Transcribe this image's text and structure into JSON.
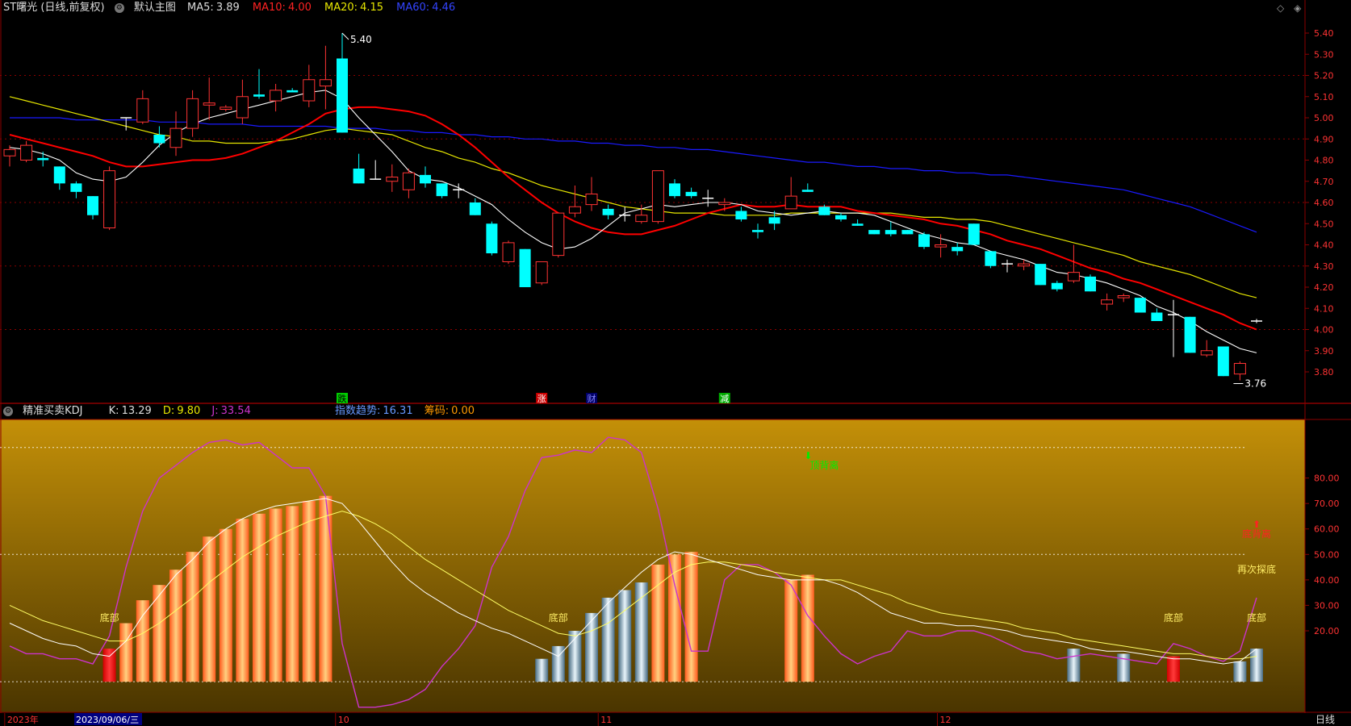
{
  "header": {
    "title": "ST曙光 (日线,前复权)",
    "main_chart_label": "默认主图",
    "ma5_label": "MA5:",
    "ma5_value": "3.89",
    "ma10_label": "MA10:",
    "ma10_value": "4.00",
    "ma20_label": "MA20:",
    "ma20_value": "4.15",
    "ma60_label": "MA60:",
    "ma60_value": "4.46",
    "window_controls": [
      "◇",
      "◈"
    ]
  },
  "sub_header": {
    "title": "精准买卖KDJ",
    "k_label": "K:",
    "k_value": "13.29",
    "d_label": "D:",
    "d_value": "9.80",
    "j_label": "J:",
    "j_value": "33.54",
    "index_trend_label": "指数趋势:",
    "index_trend_value": "16.31",
    "chips_label": "筹码:",
    "chips_value": "0.00"
  },
  "colors": {
    "up": "#ff3333",
    "down": "#00ffff",
    "ma5": "#ffffff",
    "ma10": "#ff0000",
    "ma20": "#e6e600",
    "ma60": "#1a1aff",
    "k_line": "#ffffff",
    "d_line": "#ffff66",
    "j_line": "#cc33cc",
    "grid": "#8b0000"
  },
  "chart_data": [
    {
      "type": "candlestick",
      "title": "ST曙光 (日线,前复权)",
      "y_ticks": [
        "5.40",
        "5.30",
        "5.20",
        "5.10",
        "5.00",
        "4.90",
        "4.80",
        "4.70",
        "4.60",
        "4.50",
        "4.40",
        "4.30",
        "4.20",
        "4.10",
        "4.00",
        "3.90",
        "3.80"
      ],
      "ylim": [
        3.72,
        5.48
      ],
      "annotations": {
        "max_label": "5.40",
        "min_label": "3.76"
      },
      "event_markers": [
        {
          "label": "跌",
          "index": 20
        },
        {
          "label": "涨",
          "index": 32
        },
        {
          "label": "财",
          "index": 35
        },
        {
          "label": "减",
          "index": 43
        }
      ],
      "ohlc": [
        [
          4.82,
          4.85,
          4.77,
          4.87
        ],
        [
          4.8,
          4.87,
          4.79,
          4.89
        ],
        [
          4.81,
          4.8,
          4.77,
          4.84
        ],
        [
          4.77,
          4.69,
          4.66,
          4.77
        ],
        [
          4.69,
          4.65,
          4.62,
          4.7
        ],
        [
          4.63,
          4.54,
          4.52,
          4.63
        ],
        [
          4.48,
          4.75,
          4.47,
          4.77
        ],
        [
          5.0,
          5.0,
          4.94,
          5.0
        ],
        [
          4.98,
          5.09,
          4.97,
          5.13
        ],
        [
          4.92,
          4.88,
          4.86,
          4.96
        ],
        [
          4.86,
          4.95,
          4.82,
          5.03
        ],
        [
          4.95,
          5.09,
          4.91,
          5.13
        ],
        [
          5.06,
          5.07,
          4.99,
          5.19
        ],
        [
          5.04,
          5.05,
          5.03,
          5.06
        ],
        [
          5.0,
          5.1,
          4.97,
          5.18
        ],
        [
          5.11,
          5.1,
          5.09,
          5.23
        ],
        [
          5.08,
          5.13,
          5.03,
          5.16
        ],
        [
          5.13,
          5.12,
          5.12,
          5.14
        ],
        [
          5.08,
          5.18,
          5.05,
          5.25
        ],
        [
          5.15,
          5.18,
          5.04,
          5.34
        ],
        [
          5.28,
          4.93,
          4.93,
          5.4
        ],
        [
          4.76,
          4.69,
          4.69,
          4.83
        ],
        [
          4.71,
          4.71,
          4.71,
          4.8
        ],
        [
          4.7,
          4.72,
          4.65,
          4.78
        ],
        [
          4.66,
          4.74,
          4.62,
          4.76
        ],
        [
          4.73,
          4.69,
          4.67,
          4.77
        ],
        [
          4.69,
          4.63,
          4.62,
          4.69
        ],
        [
          4.66,
          4.66,
          4.62,
          4.69
        ],
        [
          4.6,
          4.54,
          4.54,
          4.62
        ],
        [
          4.5,
          4.36,
          4.35,
          4.51
        ],
        [
          4.32,
          4.41,
          4.31,
          4.42
        ],
        [
          4.38,
          4.2,
          4.2,
          4.38
        ],
        [
          4.22,
          4.32,
          4.21,
          4.32
        ],
        [
          4.35,
          4.55,
          4.34,
          4.55
        ],
        [
          4.55,
          4.58,
          4.53,
          4.68
        ],
        [
          4.59,
          4.64,
          4.56,
          4.72
        ],
        [
          4.57,
          4.54,
          4.52,
          4.59
        ],
        [
          4.54,
          4.54,
          4.51,
          4.58
        ],
        [
          4.51,
          4.54,
          4.5,
          4.59
        ],
        [
          4.51,
          4.75,
          4.5,
          4.75
        ],
        [
          4.69,
          4.63,
          4.62,
          4.71
        ],
        [
          4.65,
          4.63,
          4.62,
          4.67
        ],
        [
          4.62,
          4.62,
          4.58,
          4.66
        ],
        [
          4.59,
          4.6,
          4.56,
          4.62
        ],
        [
          4.56,
          4.52,
          4.51,
          4.58
        ],
        [
          4.47,
          4.46,
          4.43,
          4.5
        ],
        [
          4.53,
          4.5,
          4.47,
          4.56
        ],
        [
          4.57,
          4.63,
          4.57,
          4.72
        ],
        [
          4.66,
          4.65,
          4.65,
          4.69
        ],
        [
          4.58,
          4.54,
          4.54,
          4.59
        ],
        [
          4.54,
          4.52,
          4.51,
          4.55
        ],
        [
          4.5,
          4.49,
          4.49,
          4.52
        ],
        [
          4.47,
          4.45,
          4.45,
          4.47
        ],
        [
          4.47,
          4.45,
          4.44,
          4.51
        ],
        [
          4.47,
          4.45,
          4.45,
          4.47
        ],
        [
          4.45,
          4.39,
          4.38,
          4.46
        ],
        [
          4.39,
          4.4,
          4.34,
          4.45
        ],
        [
          4.39,
          4.37,
          4.35,
          4.41
        ],
        [
          4.5,
          4.4,
          4.4,
          4.5
        ],
        [
          4.37,
          4.3,
          4.29,
          4.37
        ],
        [
          4.31,
          4.31,
          4.27,
          4.33
        ],
        [
          4.3,
          4.31,
          4.28,
          4.33
        ],
        [
          4.31,
          4.21,
          4.21,
          4.31
        ],
        [
          4.22,
          4.19,
          4.18,
          4.23
        ],
        [
          4.23,
          4.27,
          4.22,
          4.4
        ],
        [
          4.25,
          4.18,
          4.18,
          4.26
        ],
        [
          4.12,
          4.14,
          4.09,
          4.17
        ],
        [
          4.15,
          4.16,
          4.13,
          4.17
        ],
        [
          4.15,
          4.08,
          4.08,
          4.15
        ],
        [
          4.08,
          4.04,
          4.04,
          4.1
        ],
        [
          4.07,
          4.07,
          3.87,
          4.14
        ],
        [
          4.06,
          3.89,
          3.89,
          4.06
        ],
        [
          3.88,
          3.9,
          3.87,
          3.95
        ],
        [
          3.92,
          3.78,
          3.78,
          3.92
        ],
        [
          3.79,
          3.84,
          3.76,
          3.85
        ],
        [
          4.04,
          4.04,
          4.03,
          4.05
        ]
      ],
      "ma": {
        "MA5": [
          4.86,
          4.85,
          4.83,
          4.8,
          4.74,
          4.71,
          4.7,
          4.72,
          4.79,
          4.87,
          4.93,
          4.97,
          5.0,
          5.02,
          5.04,
          5.06,
          5.08,
          5.1,
          5.12,
          5.13,
          5.09,
          5.0,
          4.92,
          4.84,
          4.75,
          4.71,
          4.7,
          4.67,
          4.63,
          4.59,
          4.52,
          4.46,
          4.41,
          4.38,
          4.39,
          4.43,
          4.49,
          4.55,
          4.57,
          4.59,
          4.58,
          4.59,
          4.6,
          4.6,
          4.59,
          4.56,
          4.55,
          4.54,
          4.55,
          4.56,
          4.55,
          4.55,
          4.54,
          4.51,
          4.48,
          4.45,
          4.43,
          4.41,
          4.4,
          4.37,
          4.35,
          4.33,
          4.3,
          4.27,
          4.26,
          4.24,
          4.22,
          4.19,
          4.16,
          4.11,
          4.08,
          4.04,
          3.99,
          3.95,
          3.91,
          3.89
        ],
        "MA10": [
          4.92,
          4.9,
          4.88,
          4.86,
          4.84,
          4.82,
          4.79,
          4.77,
          4.77,
          4.78,
          4.79,
          4.8,
          4.8,
          4.81,
          4.83,
          4.86,
          4.89,
          4.93,
          4.97,
          5.02,
          5.04,
          5.05,
          5.05,
          5.04,
          5.03,
          5.01,
          4.97,
          4.92,
          4.86,
          4.79,
          4.72,
          4.66,
          4.6,
          4.55,
          4.51,
          4.48,
          4.46,
          4.45,
          4.45,
          4.47,
          4.49,
          4.52,
          4.55,
          4.57,
          4.59,
          4.58,
          4.58,
          4.59,
          4.58,
          4.58,
          4.58,
          4.56,
          4.55,
          4.54,
          4.53,
          4.52,
          4.5,
          4.49,
          4.47,
          4.45,
          4.42,
          4.4,
          4.38,
          4.35,
          4.32,
          4.29,
          4.27,
          4.24,
          4.22,
          4.19,
          4.16,
          4.13,
          4.1,
          4.07,
          4.03,
          4.0
        ],
        "MA20": [
          5.1,
          5.08,
          5.06,
          5.04,
          5.02,
          5.0,
          4.98,
          4.96,
          4.94,
          4.92,
          4.91,
          4.89,
          4.89,
          4.88,
          4.88,
          4.88,
          4.89,
          4.9,
          4.92,
          4.94,
          4.95,
          4.94,
          4.93,
          4.92,
          4.89,
          4.86,
          4.84,
          4.81,
          4.79,
          4.76,
          4.74,
          4.71,
          4.68,
          4.66,
          4.64,
          4.62,
          4.6,
          4.58,
          4.57,
          4.56,
          4.55,
          4.55,
          4.55,
          4.54,
          4.54,
          4.54,
          4.54,
          4.55,
          4.55,
          4.55,
          4.55,
          4.55,
          4.55,
          4.55,
          4.54,
          4.53,
          4.53,
          4.52,
          4.52,
          4.51,
          4.49,
          4.47,
          4.45,
          4.43,
          4.41,
          4.39,
          4.37,
          4.35,
          4.32,
          4.3,
          4.28,
          4.26,
          4.23,
          4.2,
          4.17,
          4.15
        ],
        "MA60": [
          5.0,
          5.0,
          5.0,
          5.0,
          4.99,
          4.99,
          4.99,
          4.99,
          4.99,
          4.98,
          4.98,
          4.98,
          4.97,
          4.97,
          4.97,
          4.96,
          4.96,
          4.96,
          4.96,
          4.96,
          4.95,
          4.95,
          4.95,
          4.94,
          4.94,
          4.93,
          4.93,
          4.92,
          4.92,
          4.91,
          4.91,
          4.9,
          4.9,
          4.89,
          4.89,
          4.88,
          4.88,
          4.87,
          4.87,
          4.86,
          4.86,
          4.85,
          4.85,
          4.84,
          4.83,
          4.82,
          4.81,
          4.8,
          4.79,
          4.79,
          4.78,
          4.77,
          4.77,
          4.76,
          4.76,
          4.75,
          4.75,
          4.74,
          4.74,
          4.73,
          4.73,
          4.72,
          4.71,
          4.7,
          4.69,
          4.68,
          4.67,
          4.66,
          4.64,
          4.62,
          4.6,
          4.58,
          4.55,
          4.52,
          4.49,
          4.46
        ]
      }
    },
    {
      "type": "kdj",
      "title": "精准买卖KDJ",
      "y_ticks": [
        "80.00",
        "70.00",
        "60.00",
        "50.00",
        "40.00",
        "30.00",
        "20.00"
      ],
      "ylim": [
        -12,
        103
      ],
      "reference_lines": [
        0,
        50,
        92
      ],
      "labels": [
        {
          "text": "底部",
          "index": 6,
          "value": 25
        },
        {
          "text": "底部",
          "index": 33,
          "value": 25
        },
        {
          "text": "顶背离",
          "index": 49,
          "value": 85
        },
        {
          "text": "底背离",
          "index": 75,
          "value": 58
        },
        {
          "text": "再次探底",
          "index": 75,
          "value": 44
        },
        {
          "text": "底部",
          "index": 70,
          "value": 25
        },
        {
          "text": "底部",
          "index": 75,
          "value": 25
        }
      ],
      "bars": [
        {
          "index": 6,
          "value": 13,
          "color": "red"
        },
        {
          "index": 7,
          "value": 23,
          "color": "orange"
        },
        {
          "index": 8,
          "value": 32,
          "color": "orange"
        },
        {
          "index": 9,
          "value": 38,
          "color": "orange"
        },
        {
          "index": 10,
          "value": 44,
          "color": "orange"
        },
        {
          "index": 11,
          "value": 51,
          "color": "orange"
        },
        {
          "index": 12,
          "value": 57,
          "color": "orange"
        },
        {
          "index": 13,
          "value": 60,
          "color": "orange"
        },
        {
          "index": 14,
          "value": 64,
          "color": "orange"
        },
        {
          "index": 15,
          "value": 66,
          "color": "orange"
        },
        {
          "index": 16,
          "value": 68,
          "color": "orange"
        },
        {
          "index": 17,
          "value": 69,
          "color": "orange"
        },
        {
          "index": 18,
          "value": 71,
          "color": "orange"
        },
        {
          "index": 19,
          "value": 73,
          "color": "orange"
        },
        {
          "index": 32,
          "value": 9,
          "color": "blue"
        },
        {
          "index": 33,
          "value": 14,
          "color": "blue"
        },
        {
          "index": 34,
          "value": 20,
          "color": "blue"
        },
        {
          "index": 35,
          "value": 27,
          "color": "blue"
        },
        {
          "index": 36,
          "value": 33,
          "color": "blue"
        },
        {
          "index": 37,
          "value": 36,
          "color": "blue"
        },
        {
          "index": 38,
          "value": 39,
          "color": "blue"
        },
        {
          "index": 39,
          "value": 46,
          "color": "orange"
        },
        {
          "index": 40,
          "value": 50,
          "color": "orange"
        },
        {
          "index": 41,
          "value": 51,
          "color": "orange"
        },
        {
          "index": 47,
          "value": 40,
          "color": "orange"
        },
        {
          "index": 48,
          "value": 42,
          "color": "orange"
        },
        {
          "index": 64,
          "value": 13,
          "color": "blue"
        },
        {
          "index": 67,
          "value": 11,
          "color": "blue"
        },
        {
          "index": 70,
          "value": 10,
          "color": "red"
        },
        {
          "index": 74,
          "value": 8,
          "color": "blue"
        },
        {
          "index": 75,
          "value": 13,
          "color": "blue"
        }
      ],
      "K": [
        23,
        20,
        17,
        15,
        14,
        11,
        10,
        16,
        26,
        34,
        42,
        48,
        55,
        60,
        64,
        67,
        69,
        70,
        71,
        72,
        70,
        63,
        55,
        47,
        40,
        35,
        31,
        27,
        24,
        21,
        19,
        16,
        13,
        10,
        17,
        24,
        31,
        37,
        43,
        48,
        51,
        50,
        48,
        46,
        44,
        42,
        41,
        40,
        40,
        40,
        38,
        35,
        31,
        27,
        25,
        23,
        23,
        22,
        22,
        21,
        20,
        18,
        17,
        16,
        15,
        13,
        12,
        12,
        11,
        10,
        9,
        9,
        8,
        7,
        8,
        13
      ],
      "D": [
        30,
        27,
        24,
        22,
        20,
        18,
        16,
        16,
        19,
        23,
        28,
        33,
        39,
        44,
        49,
        53,
        57,
        60,
        63,
        65,
        67,
        65,
        62,
        58,
        53,
        48,
        44,
        40,
        36,
        32,
        28,
        25,
        22,
        19,
        18,
        20,
        23,
        28,
        33,
        38,
        43,
        46,
        47,
        47,
        46,
        45,
        43,
        42,
        41,
        40,
        40,
        38,
        36,
        34,
        31,
        29,
        27,
        26,
        25,
        24,
        23,
        21,
        20,
        19,
        17,
        16,
        15,
        14,
        13,
        12,
        11,
        11,
        10,
        9,
        9,
        10
      ],
      "J": [
        14,
        11,
        11,
        9,
        9,
        7,
        18,
        45,
        67,
        80,
        85,
        90,
        94,
        95,
        93,
        94,
        89,
        84,
        84,
        73,
        15,
        -10,
        -10,
        -9,
        -7,
        -3,
        6,
        13,
        22,
        45,
        57,
        75,
        88,
        89,
        91,
        90,
        96,
        95,
        90,
        68,
        38,
        12,
        12,
        40,
        46,
        46,
        43,
        38,
        26,
        18,
        11,
        7,
        10,
        12,
        20,
        18,
        18,
        20,
        20,
        18,
        15,
        12,
        11,
        9,
        10,
        11,
        10,
        9,
        8,
        7,
        15,
        13,
        10,
        8,
        12,
        33
      ]
    }
  ],
  "x_axis": {
    "labels": [
      "2023年",
      "10",
      "11",
      "12"
    ],
    "cursor_date": "2023/09/06/三",
    "period_label": "日线"
  }
}
